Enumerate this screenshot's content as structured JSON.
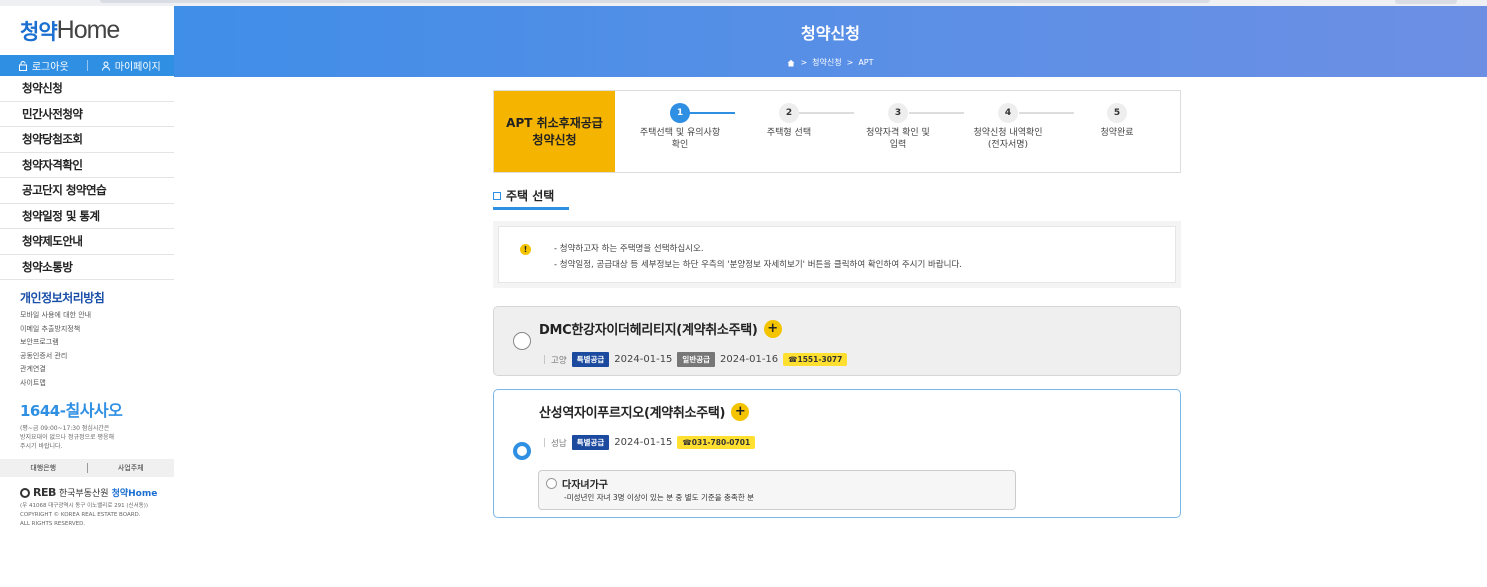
{
  "sidebar": {
    "logo_mark": "청약",
    "logo_text": "Home",
    "logout": "로그아웃",
    "mypage": "마이페이지",
    "menu": [
      "청약신청",
      "민간사전청약",
      "청약당첨조회",
      "청약자격확인",
      "공고단지 청약연습",
      "청약일정 및 통계",
      "청약제도안내",
      "청약소통방"
    ],
    "privacy": "개인정보처리방침",
    "sublinks": [
      "모바일 사용에 대한 안내",
      "이메일 추출방지정책",
      "보안프로그램",
      "공동인증서 관리",
      "관계연결",
      "사이트맵"
    ],
    "call_prefix": "1644-",
    "call_main": "칠사사오",
    "call_info": [
      "(평~금 09:00~17:30 점심시간은",
      "방지요대이 없으나 정규정으로 평응해",
      "주시기 바랍니다."
    ],
    "sub_links_bar": [
      "대행은행",
      "사업주체"
    ],
    "reb_mark": "REB",
    "reb_org": "한국부동산원",
    "reb_home": "청약Home",
    "copyright": [
      "(우 41068 대구광역시 동구 이노밸리로 291 (신서동))",
      "COPYRIGHT © KOREA REAL ESTATE BOARD.",
      "ALL RIGHTS RESERVED."
    ]
  },
  "header": {
    "title": "청약신청",
    "crumb": [
      "청약신청",
      "APT"
    ]
  },
  "steps": {
    "badge_line1": "APT 취소후재공급",
    "badge_line2": "청약신청",
    "items": [
      {
        "num": "1",
        "label1": "주택선택 및 유의사항",
        "label2": "확인"
      },
      {
        "num": "2",
        "label1": "주택형 선택",
        "label2": ""
      },
      {
        "num": "3",
        "label1": "청약자격 확인 및",
        "label2": "입력"
      },
      {
        "num": "4",
        "label1": "청약신청 내역확인",
        "label2": "(전자서명)"
      },
      {
        "num": "5",
        "label1": "청약완료",
        "label2": ""
      }
    ]
  },
  "section": {
    "title": "주택 선택"
  },
  "notice": {
    "line1": "- 청약하고자 하는 주택명을 선택하십시오.",
    "line2": "- 청약일정, 공급대상 등 세부정보는 하단 우측의 '분양정보 자세히보기' 버튼을 클릭하여 확인하여 주시기 바랍니다."
  },
  "houses": [
    {
      "name": "DMC한강자이더헤리티지(계약취소주택)",
      "region": "고양",
      "special_tag": "특별공급",
      "special_date": "2024-01-15",
      "general_tag": "일반공급",
      "general_date": "2024-01-16",
      "phone": "☎1551-3077"
    },
    {
      "name": "산성역자이푸르지오(계약취소주택)",
      "region": "성남",
      "special_tag": "특별공급",
      "special_date": "2024-01-15",
      "phone": "☎031-780-0701",
      "option_title": "다자녀가구",
      "option_desc": "-미성년인 자녀 3명 이상이 있는 분 중 별도 기준을 충족한 분"
    }
  ],
  "colors": {
    "accent": "#2f8fe3",
    "badge": "#f5b400",
    "tag_blue": "#1b4a9e",
    "phone_bg": "#ffe030"
  }
}
